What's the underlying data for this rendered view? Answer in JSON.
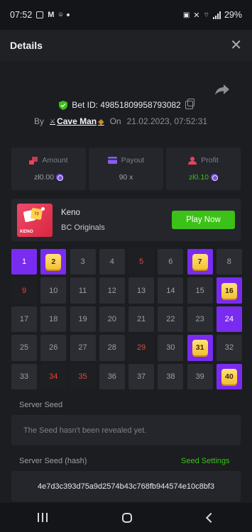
{
  "status_bar": {
    "time": "07:52",
    "battery": "29%"
  },
  "header": {
    "title": "Details",
    "close_icon": "close-icon"
  },
  "bet": {
    "id_label": "Bet ID: 49851809958793082",
    "by_label": "By",
    "user": "Cave Man",
    "on_label": "On",
    "datetime": "21.02.2023, 07:52:31"
  },
  "stats": {
    "amount": {
      "label": "Amount",
      "value": "zł0.00"
    },
    "payout": {
      "label": "Payout",
      "value": "90 x"
    },
    "profit": {
      "label": "Profit",
      "value": "zł0.10"
    }
  },
  "game": {
    "name": "Keno",
    "provider": "BC Originals",
    "thumb_label": "KENO",
    "thumb_badge": "72",
    "play_button": "Play Now"
  },
  "keno": {
    "cells": [
      {
        "n": "1",
        "state": "picked"
      },
      {
        "n": "2",
        "state": "hit"
      },
      {
        "n": "3",
        "state": "normal"
      },
      {
        "n": "4",
        "state": "normal"
      },
      {
        "n": "5",
        "state": "drawn"
      },
      {
        "n": "6",
        "state": "normal"
      },
      {
        "n": "7",
        "state": "hit"
      },
      {
        "n": "8",
        "state": "normal"
      },
      {
        "n": "9",
        "state": "drawn"
      },
      {
        "n": "10",
        "state": "normal"
      },
      {
        "n": "11",
        "state": "normal"
      },
      {
        "n": "12",
        "state": "normal"
      },
      {
        "n": "13",
        "state": "normal"
      },
      {
        "n": "14",
        "state": "normal"
      },
      {
        "n": "15",
        "state": "normal"
      },
      {
        "n": "16",
        "state": "hit"
      },
      {
        "n": "17",
        "state": "normal"
      },
      {
        "n": "18",
        "state": "normal"
      },
      {
        "n": "19",
        "state": "normal"
      },
      {
        "n": "20",
        "state": "normal"
      },
      {
        "n": "21",
        "state": "normal"
      },
      {
        "n": "22",
        "state": "normal"
      },
      {
        "n": "23",
        "state": "normal"
      },
      {
        "n": "24",
        "state": "picked"
      },
      {
        "n": "25",
        "state": "normal"
      },
      {
        "n": "26",
        "state": "normal"
      },
      {
        "n": "27",
        "state": "normal"
      },
      {
        "n": "28",
        "state": "normal"
      },
      {
        "n": "29",
        "state": "drawn"
      },
      {
        "n": "30",
        "state": "normal"
      },
      {
        "n": "31",
        "state": "hit"
      },
      {
        "n": "32",
        "state": "normal"
      },
      {
        "n": "33",
        "state": "normal"
      },
      {
        "n": "34",
        "state": "drawn"
      },
      {
        "n": "35",
        "state": "drawn"
      },
      {
        "n": "36",
        "state": "normal"
      },
      {
        "n": "37",
        "state": "normal"
      },
      {
        "n": "38",
        "state": "normal"
      },
      {
        "n": "39",
        "state": "normal"
      },
      {
        "n": "40",
        "state": "hit"
      }
    ]
  },
  "server_seed": {
    "label": "Server Seed",
    "value": "The Seed hasn't been revealed yet."
  },
  "server_seed_hash": {
    "label": "Server Seed (hash)",
    "settings_link": "Seed Settings",
    "value": "4e7d3c393d75a9d2574b43c768fb944574e10c8bf3"
  },
  "colors": {
    "accent_green": "#3bc117",
    "picked_purple": "#7a2bf0",
    "drawn_red": "#e3463d",
    "hit_gold": "#f4c033"
  }
}
